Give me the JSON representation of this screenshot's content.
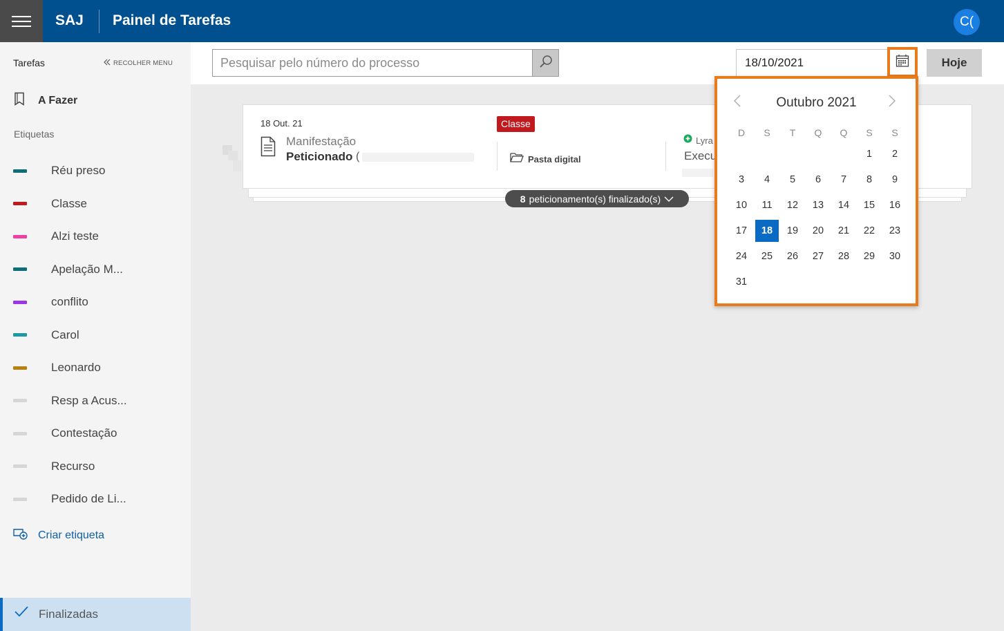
{
  "header": {
    "brand": "SAJ",
    "title": "Painel de Tarefas",
    "avatar_initials": "C("
  },
  "sidebar": {
    "title": "Tarefas",
    "collapse_label": "RECOLHER MENU",
    "todo_label": "A Fazer",
    "tags_heading": "Etiquetas",
    "tags": [
      {
        "label": "Réu preso",
        "color": "#0f6d78"
      },
      {
        "label": "Classe",
        "color": "#c0191e"
      },
      {
        "label": "Alzi teste",
        "color": "#ee3fa2"
      },
      {
        "label": "Apelação M...",
        "color": "#0f6d78"
      },
      {
        "label": "conflito",
        "color": "#9b35e8"
      },
      {
        "label": "Carol",
        "color": "#1a9ba3"
      },
      {
        "label": "Leonardo",
        "color": "#b8810e"
      },
      {
        "label": "Resp a Acus...",
        "color": "#d6d6d6"
      },
      {
        "label": "Contestação",
        "color": "#d6d6d6"
      },
      {
        "label": "Recurso",
        "color": "#d6d6d6"
      },
      {
        "label": "Pedido de Li...",
        "color": "#d6d6d6"
      }
    ],
    "create_tag_label": "Criar etiqueta",
    "finished_label": "Finalizadas"
  },
  "toolbar": {
    "search_placeholder": "Pesquisar pelo número do processo",
    "date_value": "18/10/2021",
    "today_label": "Hoje"
  },
  "task": {
    "date": "18 Out. 21",
    "type": "Manifestação",
    "status": "Peticionado",
    "paren": "(",
    "tag_badge": "Classe",
    "tag_badge_color": "#c0191e",
    "folder_label": "Pasta digital",
    "assignee": "Lyra",
    "assignee_status_color": "#1aa85a",
    "role": "Execu",
    "finished_count": "8",
    "finished_text": "peticionamento(s) finalizado(s)"
  },
  "calendar": {
    "month_label": "Outubro 2021",
    "weekdays": [
      "D",
      "S",
      "T",
      "Q",
      "Q",
      "S",
      "S"
    ],
    "first_weekday_index": 5,
    "days_in_month": 31,
    "selected_day": 18,
    "accent_color": "#0b6bc4"
  },
  "colors": {
    "header_bg": "#004f8f",
    "highlight": "#e87b1c"
  }
}
